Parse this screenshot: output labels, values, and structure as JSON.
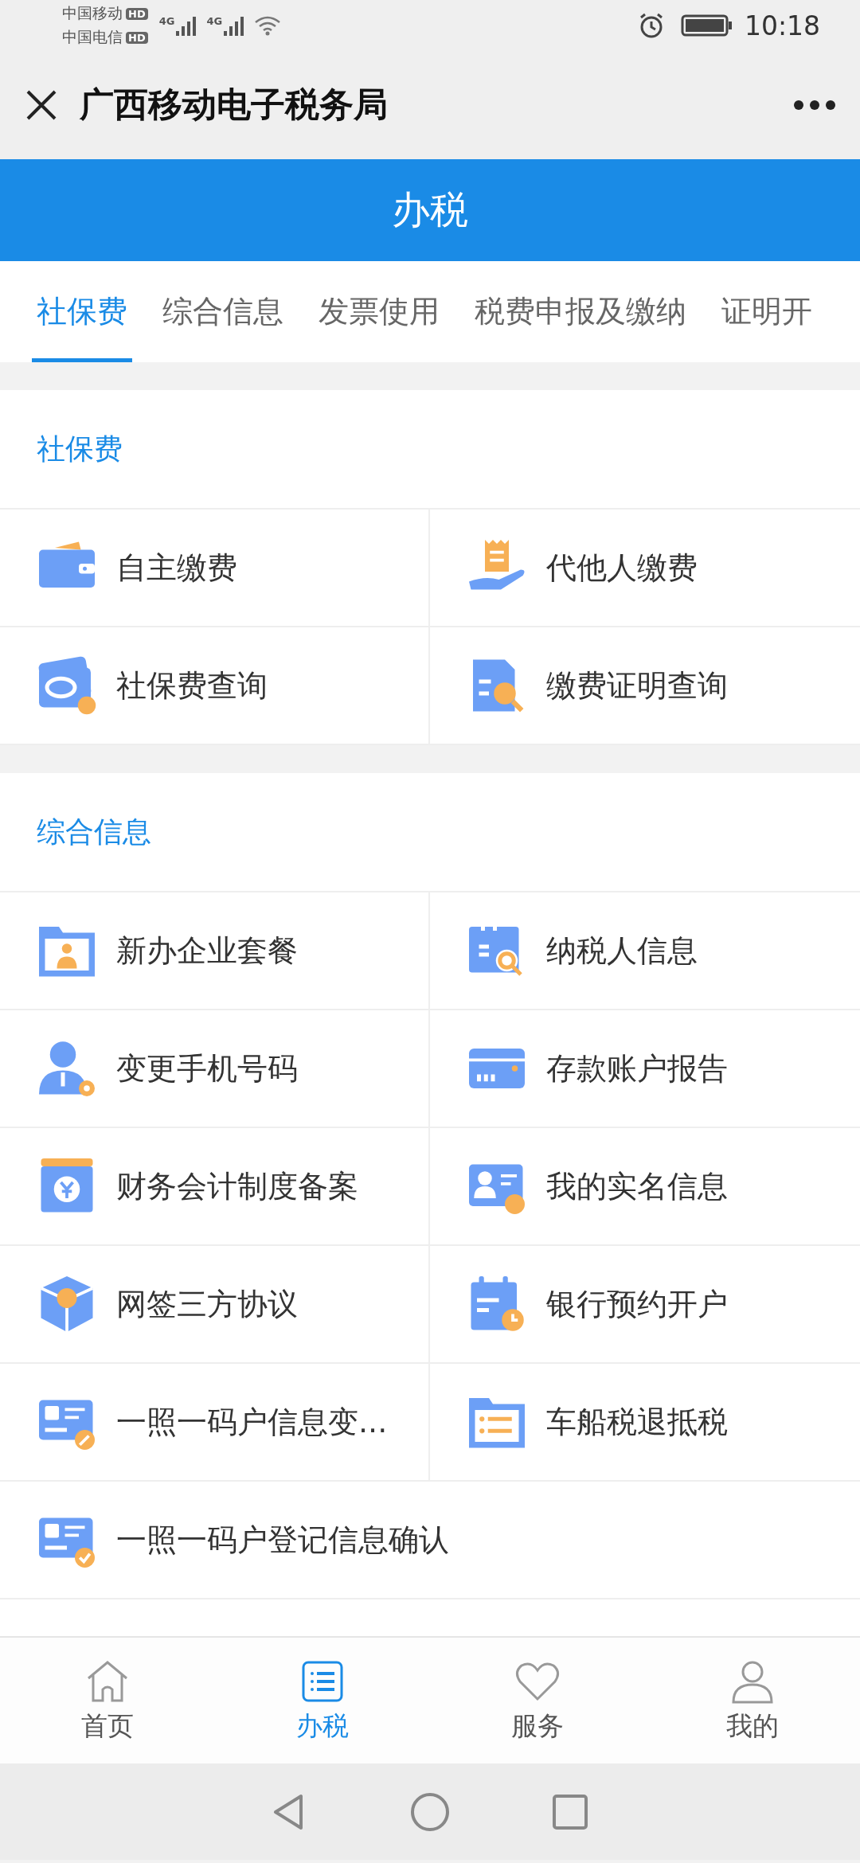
{
  "status_bar": {
    "carriers": [
      {
        "name": "中国移动",
        "badge": "HD",
        "network": "4G"
      },
      {
        "name": "中国电信",
        "badge": "HD",
        "network": "4G"
      }
    ],
    "time": "10:18"
  },
  "header": {
    "title": "广西移动电子税务局"
  },
  "banner": {
    "title": "办税"
  },
  "tabs": [
    {
      "label": "社保费",
      "selected": true
    },
    {
      "label": "综合信息",
      "selected": false
    },
    {
      "label": "发票使用",
      "selected": false
    },
    {
      "label": "税费申报及缴纳",
      "selected": false
    },
    {
      "label": "证明开",
      "selected": false
    }
  ],
  "sections": [
    {
      "title": "社保费",
      "items": [
        {
          "label": "自主缴费"
        },
        {
          "label": "代他人缴费"
        },
        {
          "label": "社保费查询"
        },
        {
          "label": "缴费证明查询"
        }
      ]
    },
    {
      "title": "综合信息",
      "items": [
        {
          "label": "新办企业套餐"
        },
        {
          "label": "纳税人信息"
        },
        {
          "label": "变更手机号码"
        },
        {
          "label": "存款账户报告"
        },
        {
          "label": "财务会计制度备案"
        },
        {
          "label": "我的实名信息"
        },
        {
          "label": "网签三方协议"
        },
        {
          "label": "银行预约开户"
        },
        {
          "label": "一照一码户信息变..."
        },
        {
          "label": "车船税退抵税"
        },
        {
          "label": "一照一码户登记信息确认"
        }
      ]
    }
  ],
  "bottom_nav": [
    {
      "label": "首页",
      "selected": false
    },
    {
      "label": "办税",
      "selected": true
    },
    {
      "label": "服务",
      "selected": false
    },
    {
      "label": "我的",
      "selected": false
    }
  ]
}
